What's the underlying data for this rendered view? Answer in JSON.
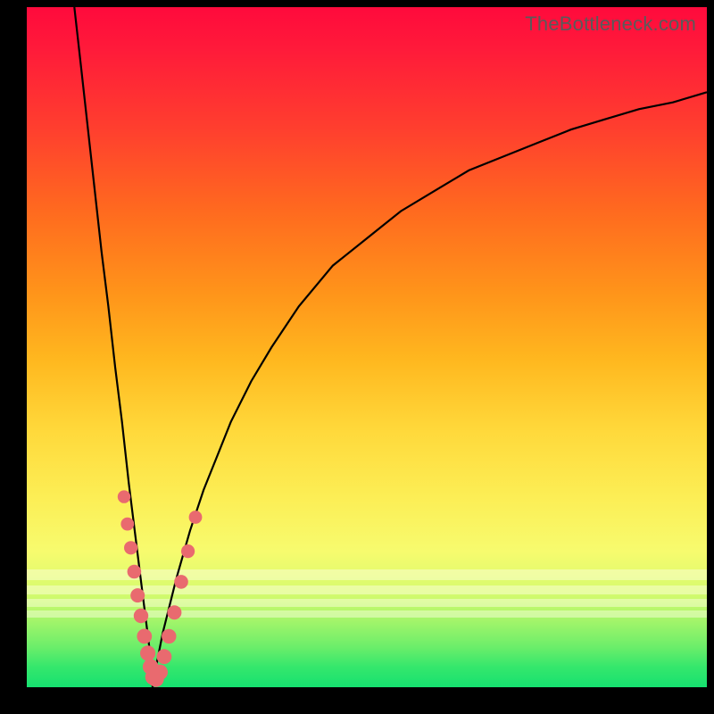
{
  "attribution": "TheBottleneck.com",
  "colors": {
    "dot": "#e96a6f",
    "curve": "#000000",
    "frame": "#000000"
  },
  "chart_data": {
    "type": "line",
    "title": "",
    "xlabel": "",
    "ylabel": "",
    "xlim": [
      0,
      100
    ],
    "ylim": [
      0,
      100
    ],
    "x_min_curve": 18.5,
    "series": [
      {
        "name": "bottleneck-curve",
        "comment": "V-shaped curve; y≈100 at x≈7 and falls to 0 at x≈18.5, then rises asymptotically toward ~88 as x→100",
        "x": [
          7,
          8,
          9,
          10,
          11,
          12,
          13,
          14,
          15,
          16,
          17,
          18,
          18.5,
          19,
          20,
          22,
          24,
          26,
          28,
          30,
          33,
          36,
          40,
          45,
          50,
          55,
          60,
          65,
          70,
          75,
          80,
          85,
          90,
          95,
          100
        ],
        "y": [
          100,
          91,
          82,
          73,
          64,
          56,
          47,
          39,
          30,
          22,
          14,
          6,
          0,
          3,
          8,
          16,
          23,
          29,
          34,
          39,
          45,
          50,
          56,
          62,
          66,
          70,
          73,
          76,
          78,
          80,
          82,
          83.5,
          85,
          86,
          87.5
        ]
      },
      {
        "name": "highlight-dots",
        "comment": "salmon markers clustered around the valley of the V",
        "x": [
          14.3,
          14.8,
          15.3,
          15.8,
          16.3,
          16.8,
          17.3,
          17.8,
          18.2,
          18.6,
          19.0,
          19.6,
          20.2,
          20.9,
          21.7,
          22.7,
          23.7,
          24.8
        ],
        "y": [
          28,
          24,
          20.5,
          17,
          13.5,
          10.5,
          7.5,
          5,
          3,
          1.5,
          1.2,
          2.2,
          4.5,
          7.5,
          11,
          15.5,
          20,
          25
        ]
      }
    ],
    "gradient_stops": [
      {
        "pos": 0,
        "color": "#ff0a3c"
      },
      {
        "pos": 50,
        "color": "#ffc733"
      },
      {
        "pos": 82,
        "color": "#f5fa70"
      },
      {
        "pos": 100,
        "color": "#16e170"
      }
    ],
    "pale_bands_y": [
      18,
      16,
      14,
      12
    ]
  }
}
